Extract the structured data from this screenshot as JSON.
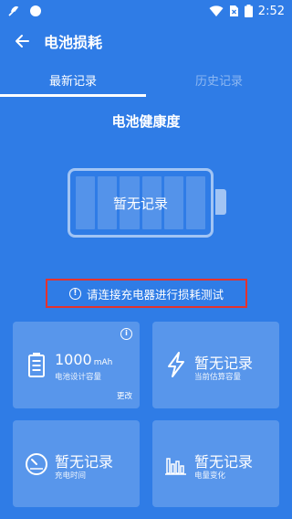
{
  "status_bar": {
    "time": "2:52"
  },
  "appbar": {
    "title": "电池损耗"
  },
  "tabs": [
    {
      "label": "最新记录",
      "active": true
    },
    {
      "label": "历史记录",
      "active": false
    }
  ],
  "health": {
    "title": "电池健康度",
    "battery_text": "暂无记录"
  },
  "warning": {
    "text": "请连接充电器进行损耗测试"
  },
  "cards": {
    "design_capacity": {
      "value": "1000",
      "unit": "mAh",
      "label": "电池设计容量",
      "edit": "更改"
    },
    "estimated_capacity": {
      "value": "暂无记录",
      "label": "当前估算容量"
    },
    "charge_time": {
      "value": "暂无记录",
      "label": "充电时间"
    },
    "charge_change": {
      "value": "暂无记录",
      "label": "电量变化"
    }
  },
  "colors": {
    "background": "#2f7ce6",
    "warning_border": "#e5322d"
  }
}
